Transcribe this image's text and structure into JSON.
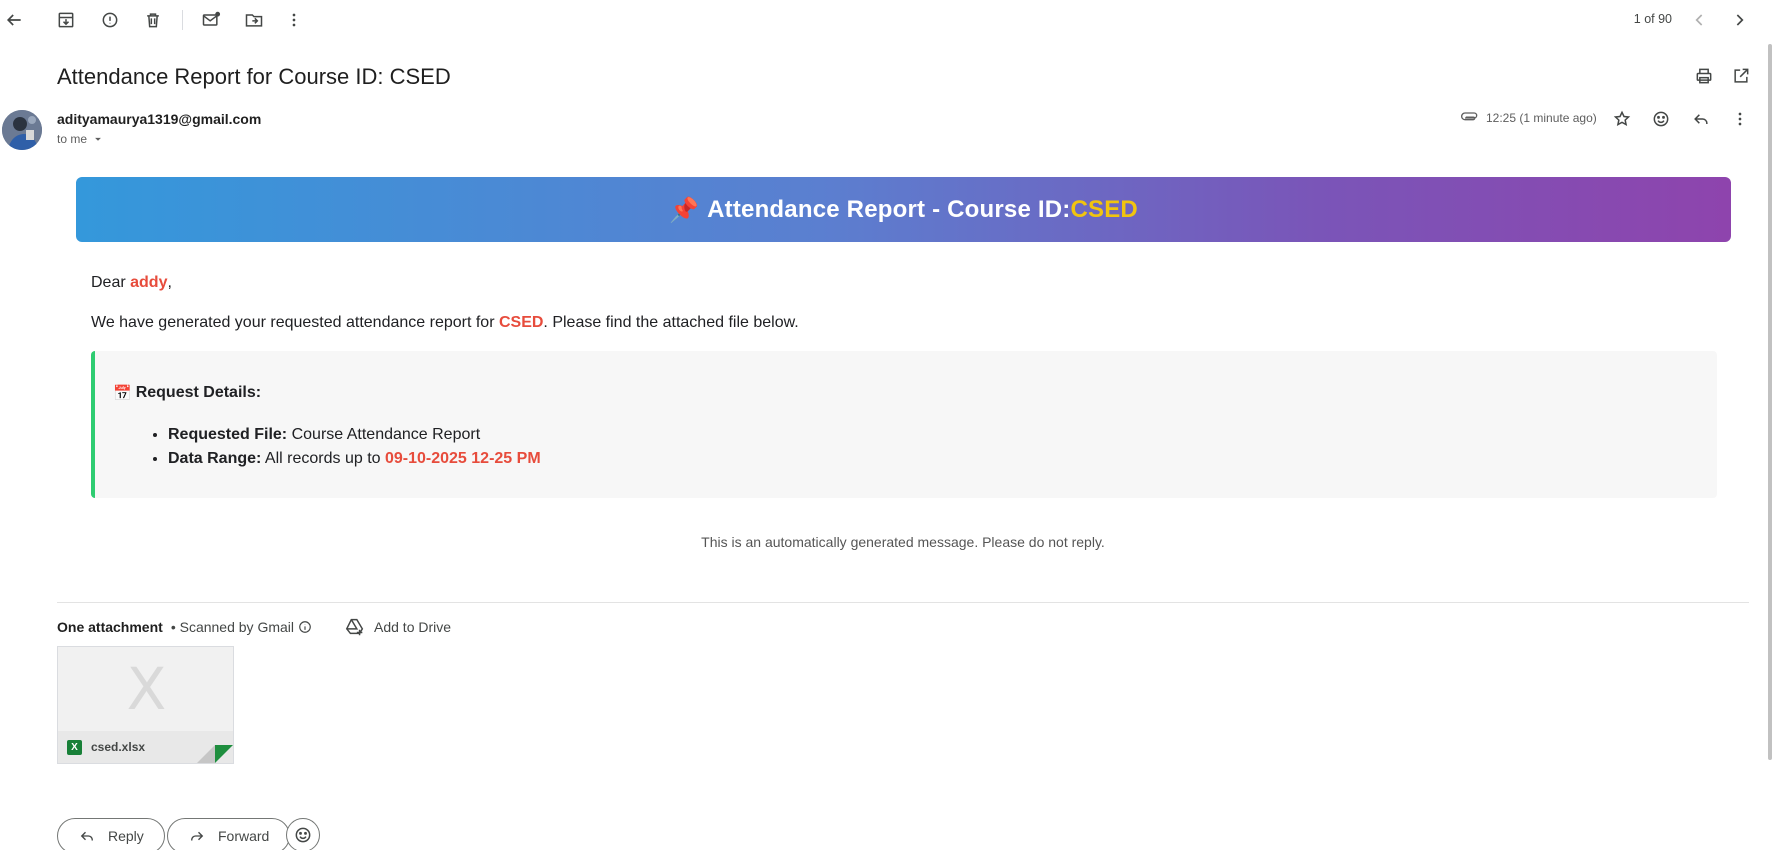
{
  "toolbar": {
    "back": "arrow-left-icon",
    "archive": "archive-icon",
    "spam": "report-spam-icon",
    "delete": "trash-icon",
    "mark_unread": "mark-unread-icon",
    "move": "move-to-icon",
    "more": "more-vertical-icon",
    "pager": "1 of 90"
  },
  "email": {
    "subject": "Attendance Report for Course ID: CSED",
    "sender_email": "adityamaurya1319@gmail.com",
    "recipient_label": "to me",
    "timestamp": "12:25 (1 minute ago)"
  },
  "body": {
    "banner_pin": "📌",
    "banner_prefix": "Attendance Report - Course ID: ",
    "banner_course": "CSED",
    "greeting_prefix": "Dear ",
    "recipient_name": "addy",
    "greeting_suffix": ",",
    "intro_prefix": "We have generated your requested attendance report for ",
    "intro_course": "CSED",
    "intro_suffix": ". Please find the attached file below.",
    "details_icon": "📅",
    "details_title": "Request Details:",
    "requested_file_label": "Requested File:",
    "requested_file_value": " Course Attendance Report",
    "data_range_label": "Data Range:",
    "data_range_prefix": " All records up to ",
    "data_range_date": "09-10-2025 12-25 PM",
    "auto_message": "This is an automatically generated message. Please do not reply."
  },
  "attachments": {
    "count_label": "One attachment",
    "scanned_label": " • Scanned by Gmail",
    "add_to_drive": "Add to Drive",
    "preview_letter": "X",
    "file_type_badge": "X",
    "file_name": "csed.xlsx"
  },
  "actions": {
    "reply": "Reply",
    "forward": "Forward"
  },
  "colors": {
    "accent_red": "#e74c3c",
    "accent_yellow": "#f1c40f",
    "accent_green": "#2ecc71",
    "gradient_start": "#3498db",
    "gradient_end": "#8e44ad"
  }
}
